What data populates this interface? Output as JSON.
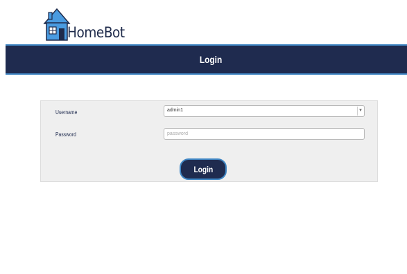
{
  "app": {
    "logo_text": "HomeBot"
  },
  "header": {
    "title": "Login"
  },
  "form": {
    "username_label": "Username",
    "username_value": "admin1",
    "password_label": "Password",
    "password_placeholder": "password",
    "login_button": "Login"
  },
  "colors": {
    "navy": "#1f2b4f",
    "accent_blue": "#3f86c4",
    "panel_bg": "#efefef"
  },
  "icons": {
    "logo": "house-icon",
    "select_arrow": "chevron-down-icon"
  }
}
